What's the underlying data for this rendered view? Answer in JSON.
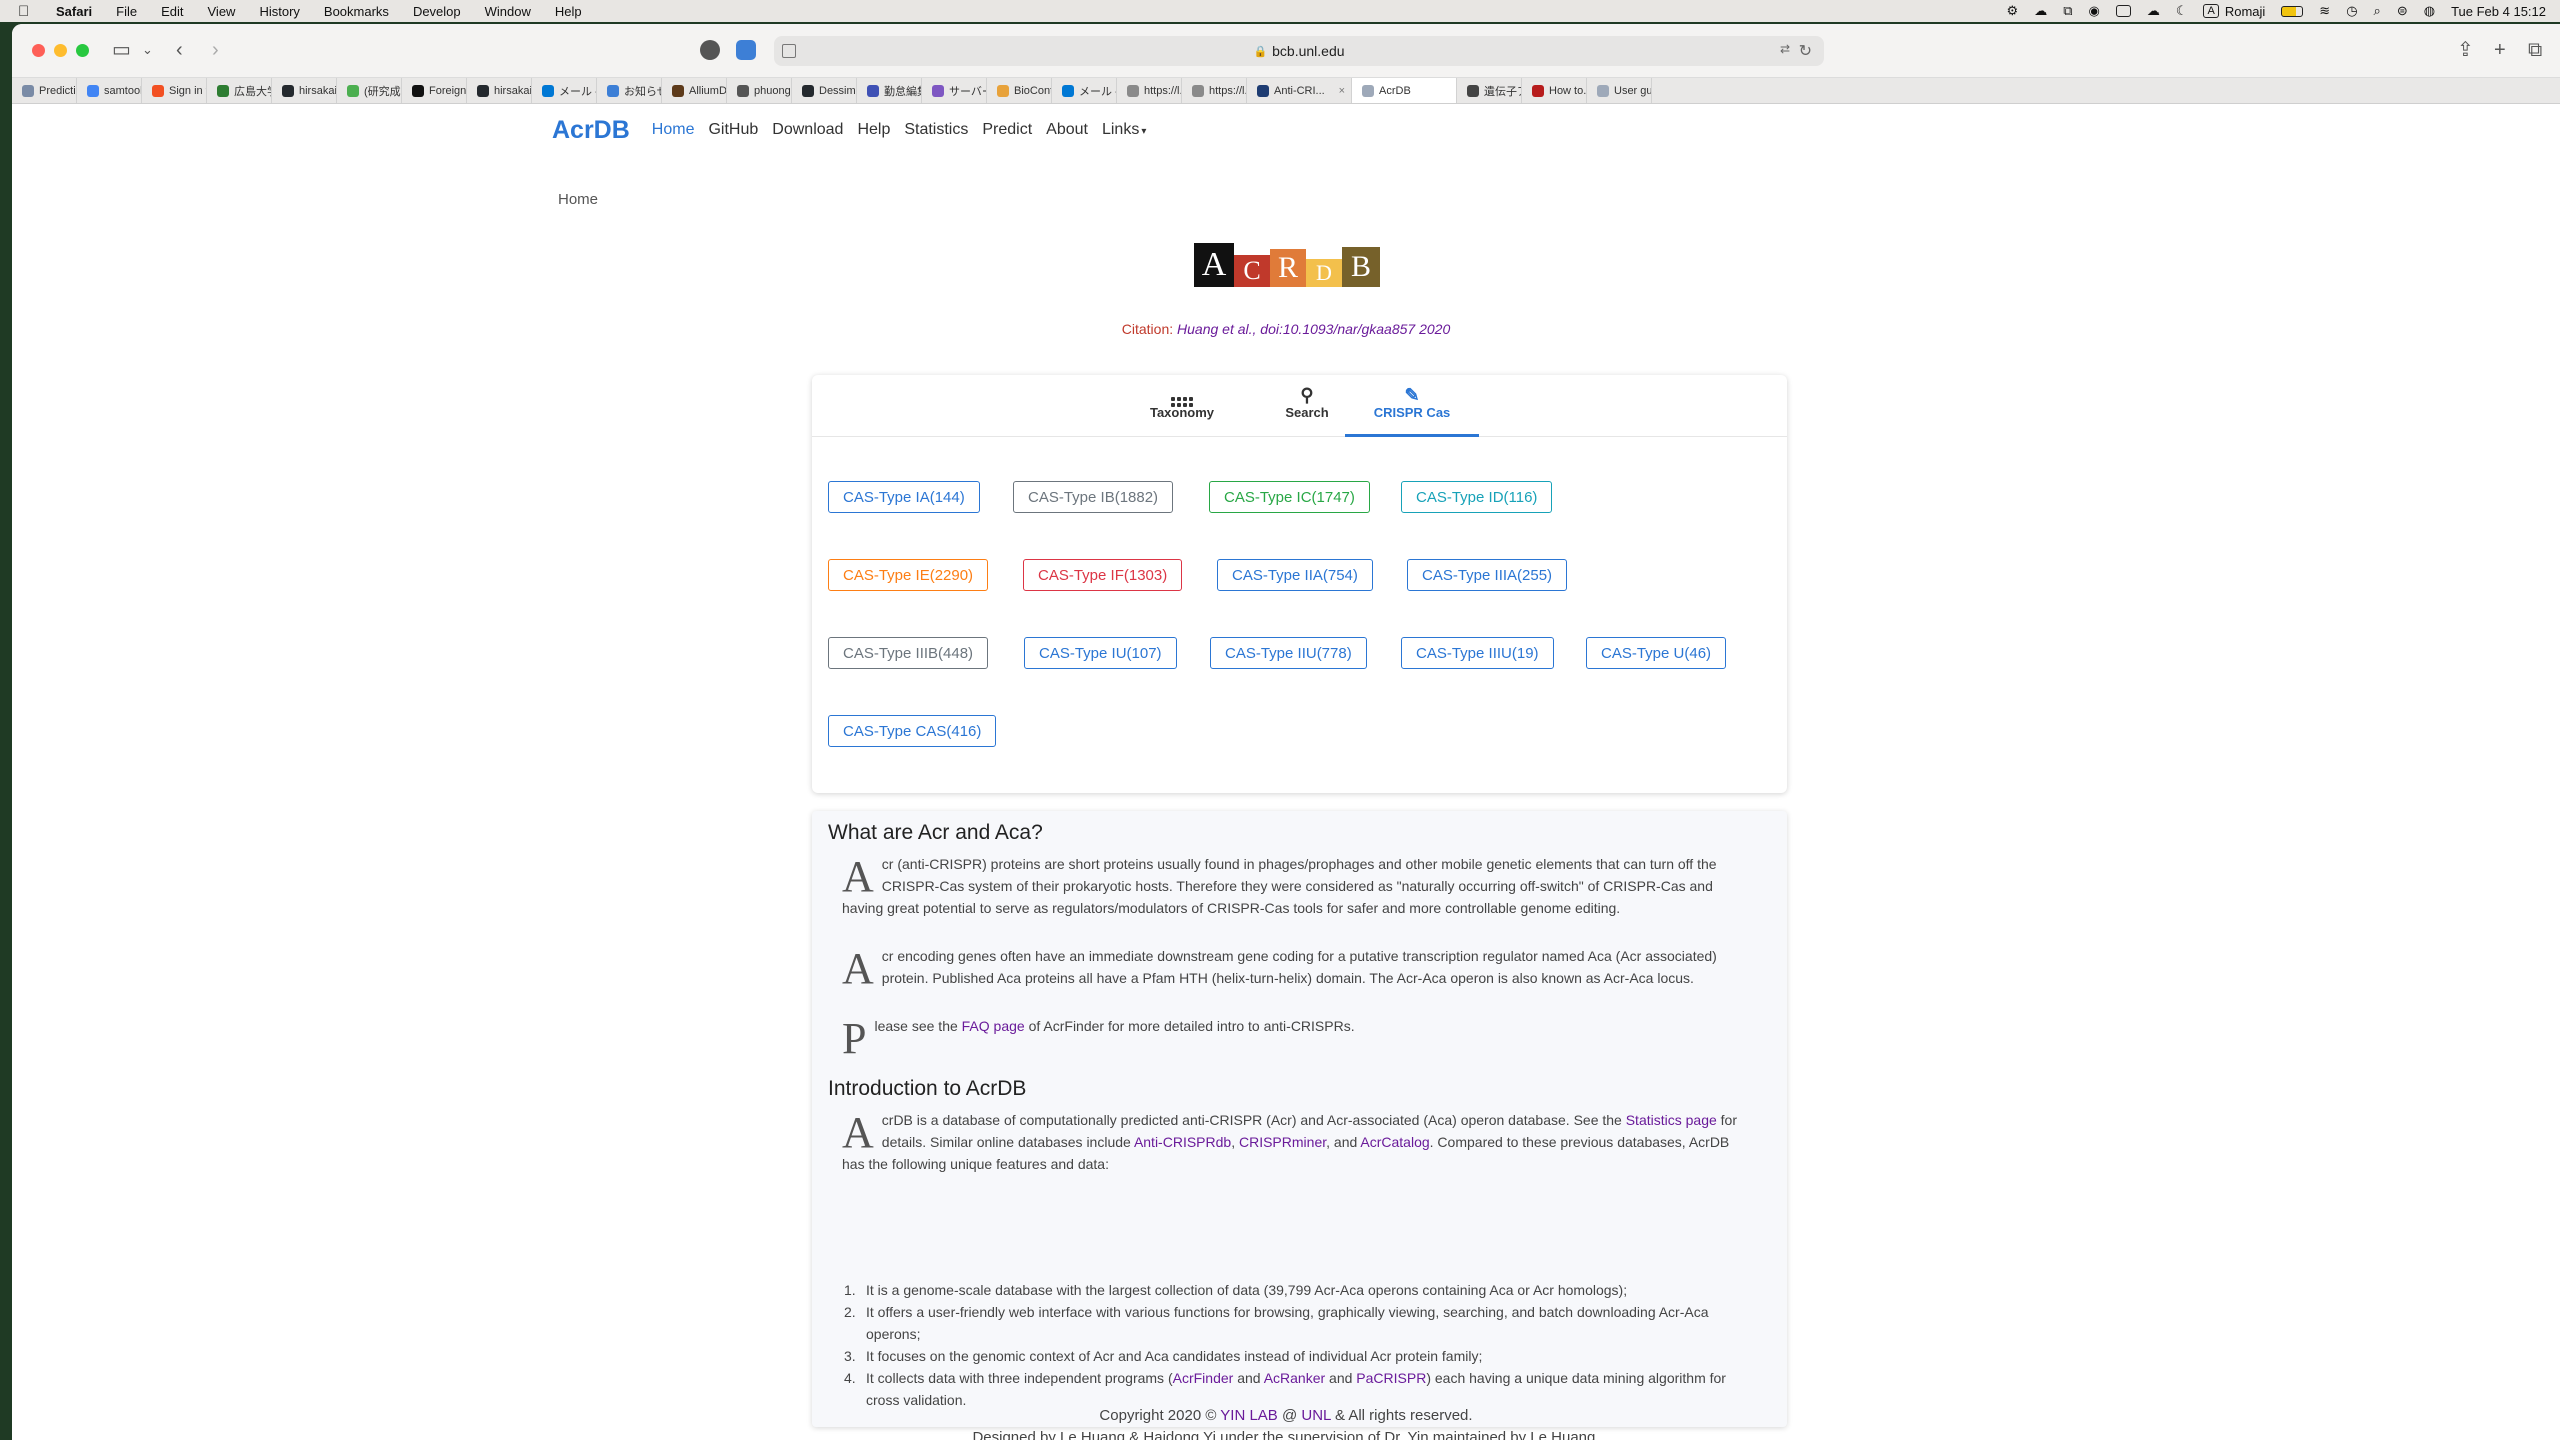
{
  "menubar": {
    "app": "Safari",
    "items": [
      "File",
      "Edit",
      "View",
      "History",
      "Bookmarks",
      "Develop",
      "Window",
      "Help"
    ],
    "ime": "Romaji",
    "ime_letter": "A",
    "datetime": "Tue Feb 4  15:12"
  },
  "browser": {
    "url": "bcb.unl.edu",
    "tabs": [
      {
        "label": "Predicti...",
        "color": "#7a8ba6"
      },
      {
        "label": "samtool...",
        "color": "#4285f4"
      },
      {
        "label": "Sign in t...",
        "color": "#f25022"
      },
      {
        "label": "広島大学",
        "color": "#2e7d32"
      },
      {
        "label": "hirsakai/...",
        "color": "#24292e"
      },
      {
        "label": "(研究成...",
        "color": "#4caf50"
      },
      {
        "label": "Foreign...",
        "color": "#111111"
      },
      {
        "label": "hirsakai/...",
        "color": "#24292e"
      },
      {
        "label": "メール -...",
        "color": "#0078d4"
      },
      {
        "label": "お知らせ...",
        "color": "#3d7fd6"
      },
      {
        "label": "AlliumD...",
        "color": "#5d3a1a"
      },
      {
        "label": "phuong...",
        "color": "#555555"
      },
      {
        "label": "Dessimo...",
        "color": "#24292e"
      },
      {
        "label": "勤怠編集...",
        "color": "#3f51b5"
      },
      {
        "label": "サーバー...",
        "color": "#7e57c2"
      },
      {
        "label": "BioCont...",
        "color": "#e8a23a"
      },
      {
        "label": "メール -...",
        "color": "#0078d4"
      },
      {
        "label": "https://l...",
        "color": "#8a8a8a"
      },
      {
        "label": "https://l...",
        "color": "#8a8a8a"
      },
      {
        "label": "Anti-CRI...",
        "color": "#1e3c72"
      },
      {
        "label": "AcrDB",
        "color": "#9ea9b9"
      },
      {
        "label": "遺伝子ア...",
        "color": "#444444"
      },
      {
        "label": "How to...",
        "color": "#b71c1c"
      },
      {
        "label": "User gui...",
        "color": "#9ea9b9"
      }
    ]
  },
  "nav": {
    "brand": "AcrDB",
    "links": [
      "Home",
      "GitHub",
      "Download",
      "Help",
      "Statistics",
      "Predict",
      "About",
      "Links"
    ]
  },
  "breadcrumb": "Home",
  "logo_letters": [
    "A",
    "C",
    "R",
    "D",
    "B"
  ],
  "citation": {
    "label": "Citation:",
    "ref": "Huang et al., doi:10.1093/nar/gkaa857 2020"
  },
  "search_tabs": [
    {
      "label": "Taxonomy",
      "icon": "grid-dots-icon"
    },
    {
      "label": "Search",
      "icon": "search-icon"
    },
    {
      "label": "CRISPR Cas",
      "icon": "feather-icon"
    }
  ],
  "cas_types": [
    {
      "label": "CAS-Type IA(144)",
      "color": "#2b76d4"
    },
    {
      "label": "CAS-Type IB(1882)",
      "color": "#6c757d"
    },
    {
      "label": "CAS-Type IC(1747)",
      "color": "#28a745"
    },
    {
      "label": "CAS-Type ID(116)",
      "color": "#17a2b8"
    },
    {
      "label": "CAS-Type IE(2290)",
      "color": "#fd7e14"
    },
    {
      "label": "CAS-Type IF(1303)",
      "color": "#dc3545"
    },
    {
      "label": "CAS-Type IIA(754)",
      "color": "#2b76d4"
    },
    {
      "label": "CAS-Type IIIA(255)",
      "color": "#2b76d4"
    },
    {
      "label": "CAS-Type IIIB(448)",
      "color": "#6c757d"
    },
    {
      "label": "CAS-Type IU(107)",
      "color": "#2b76d4"
    },
    {
      "label": "CAS-Type IIU(778)",
      "color": "#2b76d4"
    },
    {
      "label": "CAS-Type IIIU(19)",
      "color": "#2b76d4"
    },
    {
      "label": "CAS-Type U(46)",
      "color": "#2b76d4"
    },
    {
      "label": "CAS-Type CAS(416)",
      "color": "#2b76d4"
    }
  ],
  "about": {
    "heading1": "What are Acr and Aca?",
    "p1": {
      "drop": "A",
      "text": "cr (anti-CRISPR) proteins are short proteins usually found in phages/prophages and other mobile genetic elements that can turn off the CRISPR-Cas system of their prokaryotic hosts. Therefore they were considered as \"naturally occurring off-switch\" of CRISPR-Cas and having great potential to serve as regulators/modulators of CRISPR-Cas tools for safer and more controllable genome editing."
    },
    "p2": {
      "drop": "A",
      "text": "cr encoding genes often have an immediate downstream gene coding for a putative transcription regulator named Aca (Acr associated) protein. Published Aca proteins all have a Pfam HTH (helix-turn-helix) domain. The Acr-Aca operon is also known as Acr-Aca locus."
    },
    "p3": {
      "drop": "P",
      "pre": "lease see the ",
      "link": "FAQ page",
      "post": " of AcrFinder for more detailed intro to anti-CRISPRs."
    },
    "heading2": "Introduction to AcrDB",
    "p4": {
      "drop": "A",
      "t1": "crDB is a database of computationally predicted anti-CRISPR (Acr) and Acr-associated (Aca) operon database. See the ",
      "l1": "Statistics page",
      "t2": " for details. Similar online databases include ",
      "l2": "Anti-CRISPRdb",
      "t3": ", ",
      "l3": "CRISPRminer",
      "t4": ", and ",
      "l4": "AcrCatalog",
      "t5": ". Compared to these previous databases, AcrDB has the following unique features and data:"
    },
    "features": [
      "It is a genome-scale database with the largest collection of data (39,799 Acr-Aca operons containing Aca or Acr homologs);",
      "It offers a user-friendly web interface with various functions for browsing, graphically viewing, searching, and batch downloading Acr-Aca operons;",
      "It focuses on the genomic context of Acr and Aca candidates instead of individual Acr protein family;"
    ],
    "feature4": {
      "t1": "It collects data with three independent programs (",
      "l1": "AcrFinder",
      "t2": " and ",
      "l2": "AcRanker",
      "t3": " and ",
      "l3": "PaCRISPR",
      "t4": ") each having a unique data mining algorithm for cross validation."
    }
  },
  "footer": {
    "t1": "Copyright 2020 © ",
    "l1": "YIN LAB",
    "t2": " @ ",
    "l2": "UNL",
    "t3": " & All rights reserved.",
    "line2": "Designed by Le Huang & Haidong Yi under the supervision of Dr. Yin maintained by Le Huang."
  }
}
